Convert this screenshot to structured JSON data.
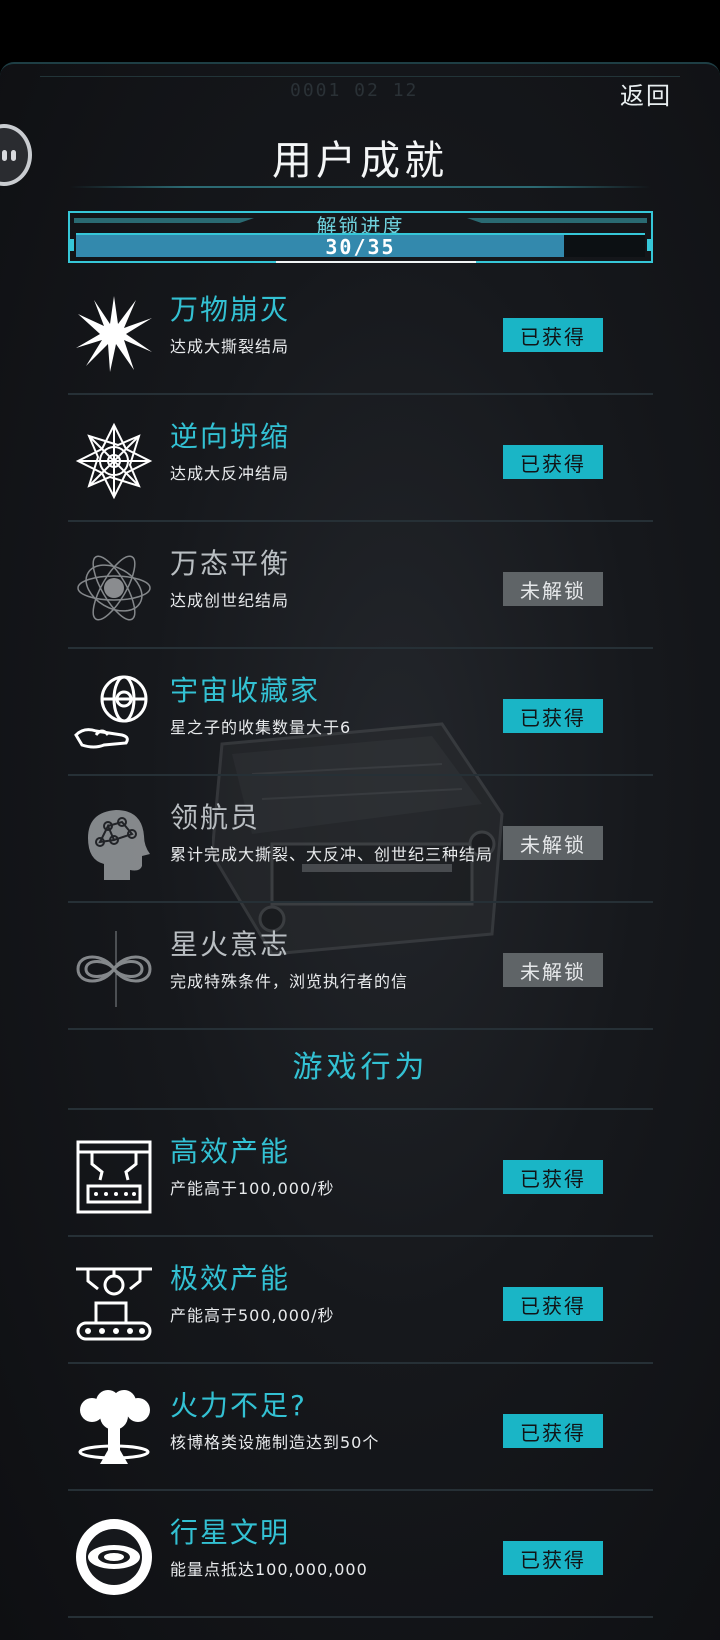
{
  "header": {
    "faint_code": "0001 02 12",
    "back_label": "返回",
    "title": "用户成就"
  },
  "progress": {
    "label": "解锁进度",
    "value_text": "30/35",
    "fraction": 0.857
  },
  "achievements": [
    {
      "name": "万物崩灭",
      "desc": "达成大撕裂结局",
      "status": "已获得",
      "earned": true,
      "icon": "starburst-icon"
    },
    {
      "name": "逆向坍缩",
      "desc": "达成大反冲结局",
      "status": "已获得",
      "earned": true,
      "icon": "mandala-icon"
    },
    {
      "name": "万态平衡",
      "desc": "达成创世纪结局",
      "status": "未解锁",
      "earned": false,
      "icon": "atom-icon"
    },
    {
      "name": "宇宙收藏家",
      "desc": "星之子的收集数量大于6",
      "status": "已获得",
      "earned": true,
      "icon": "globe-in-hand-icon"
    },
    {
      "name": "领航员",
      "desc": "累计完成大撕裂、大反冲、创世纪三种结局",
      "status": "未解锁",
      "earned": false,
      "icon": "brain-head-icon"
    },
    {
      "name": "星火意志",
      "desc": "完成特殊条件，浏览执行者的信",
      "status": "未解锁",
      "earned": false,
      "icon": "infinity-icon"
    }
  ],
  "section_game": "游戏行为",
  "behaviors": [
    {
      "name": "高效产能",
      "desc": "产能高于100,000/秒",
      "status": "已获得",
      "earned": true,
      "icon": "factory-icon"
    },
    {
      "name": "极效产能",
      "desc": "产能高于500,000/秒",
      "status": "已获得",
      "earned": true,
      "icon": "conveyor-icon"
    },
    {
      "name": "火力不足?",
      "desc": "核博格类设施制造达到50个",
      "status": "已获得",
      "earned": true,
      "icon": "mushroom-cloud-icon"
    },
    {
      "name": "行星文明",
      "desc": "能量点抵达100,000,000",
      "status": "已获得",
      "earned": true,
      "icon": "planet-eye-icon"
    }
  ],
  "colors": {
    "accent": "#1ab5c6",
    "locked": "#5f6467",
    "progress_fill": "#3389ad"
  }
}
